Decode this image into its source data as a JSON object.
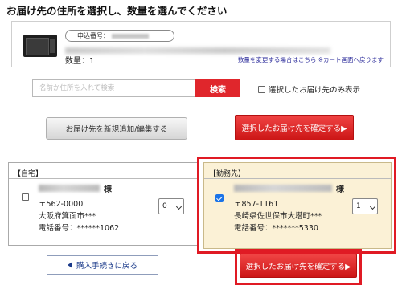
{
  "page": {
    "title": "お届け先の住所を選択し、数量を選んでください"
  },
  "product": {
    "order_label": "申込番号：",
    "quantity_text": "数量：1",
    "change_link": "数量を変更する場合はこちら ※カート画面へ戻ります"
  },
  "search": {
    "placeholder": "名前か住所を入れて検索",
    "button_label": "検索",
    "selected_only_label": "選択したお届け先のみ表示"
  },
  "actions": {
    "manage_label": "お届け先を新規追加/編集する",
    "confirm_label": "選択したお届け先を確定する▶",
    "back_label": "購入手続きに戻る"
  },
  "addresses": [
    {
      "header": "【自宅】",
      "honorific": "様",
      "postal": "〒562-0000",
      "address": "大阪府箕面市***",
      "phone": "電話番号：******1062",
      "quantity": "0",
      "selected": false
    },
    {
      "header": "【勤務先】",
      "honorific": "様",
      "postal": "〒857-1161",
      "address": "長崎県佐世保市大塔町***",
      "phone": "電話番号：*******5330",
      "quantity": "1",
      "selected": true
    }
  ],
  "colors": {
    "accent_red": "#e0262c",
    "highlight_outline": "#e01a24",
    "selected_card_bg": "#fbf1d6",
    "checkbox_blue": "#1a73e8",
    "link_blue": "#1a3a8a"
  }
}
